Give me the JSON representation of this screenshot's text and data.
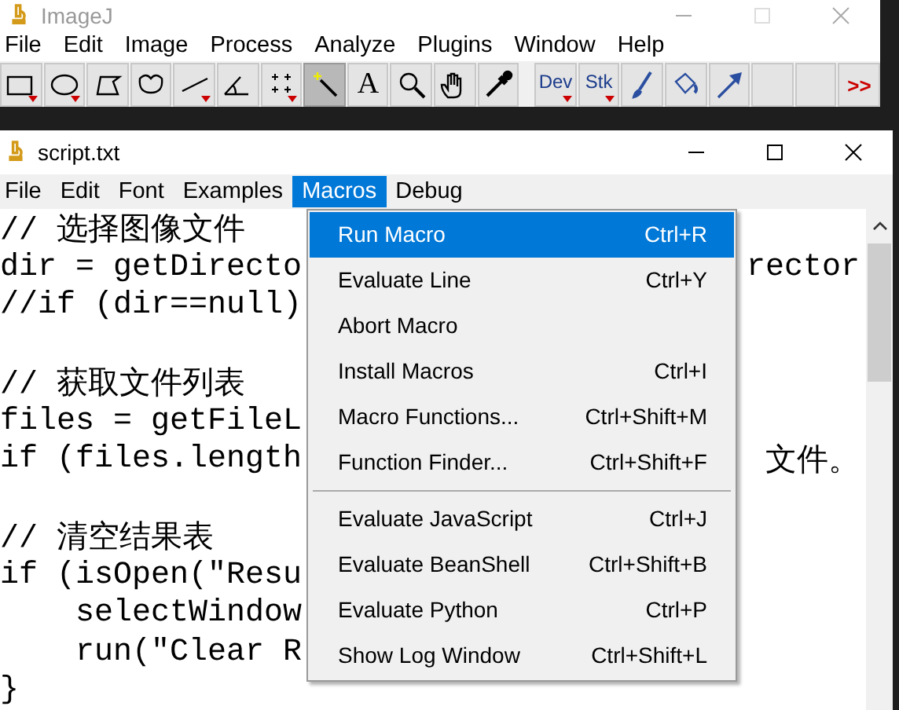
{
  "imagej": {
    "title": "ImageJ",
    "menu": [
      "File",
      "Edit",
      "Image",
      "Process",
      "Analyze",
      "Plugins",
      "Window",
      "Help"
    ],
    "tools": [
      {
        "kind": "rect",
        "selected": false,
        "has_menu": true
      },
      {
        "kind": "oval",
        "selected": false,
        "has_menu": true
      },
      {
        "kind": "polygon",
        "selected": false,
        "has_menu": false
      },
      {
        "kind": "freehand",
        "selected": false,
        "has_menu": false
      },
      {
        "kind": "line",
        "selected": false,
        "has_menu": true
      },
      {
        "kind": "angle",
        "selected": false,
        "has_menu": false
      },
      {
        "kind": "points",
        "selected": false,
        "has_menu": true
      },
      {
        "kind": "wand",
        "selected": true,
        "has_menu": false
      },
      {
        "kind": "textglyph",
        "selected": false,
        "has_menu": false,
        "label": "A"
      },
      {
        "kind": "magnifier",
        "selected": false,
        "has_menu": false
      },
      {
        "kind": "hand",
        "selected": false,
        "has_menu": false
      },
      {
        "kind": "dropper",
        "selected": false,
        "has_menu": false
      },
      {
        "kind": "label",
        "selected": false,
        "has_menu": true,
        "label": "Dev",
        "gap": true
      },
      {
        "kind": "label",
        "selected": false,
        "has_menu": true,
        "label": "Stk"
      },
      {
        "kind": "brush",
        "selected": false,
        "has_menu": false
      },
      {
        "kind": "bucket",
        "selected": false,
        "has_menu": false
      },
      {
        "kind": "arrow",
        "selected": false,
        "has_menu": false
      },
      {
        "kind": "blank",
        "selected": false,
        "has_menu": false
      },
      {
        "kind": "blank",
        "selected": false,
        "has_menu": false
      },
      {
        "kind": "more",
        "selected": false,
        "has_menu": false,
        "label": ">>"
      }
    ]
  },
  "editor": {
    "title": "script.txt",
    "menu": [
      {
        "label": "File",
        "selected": false
      },
      {
        "label": "Edit",
        "selected": false
      },
      {
        "label": "Font",
        "selected": false
      },
      {
        "label": "Examples",
        "selected": false
      },
      {
        "label": "Macros",
        "selected": true
      },
      {
        "label": "Debug",
        "selected": false
      }
    ],
    "blocks": [
      {
        "lines": [
          {
            "text": "// 选择图像文件"
          },
          {
            "text": "dir = getDirecto",
            "tail": "rector"
          },
          {
            "text": "//if (dir==null)"
          }
        ]
      },
      {
        "lines": [
          {
            "text": "// 获取文件列表"
          },
          {
            "text": "files = getFileL"
          },
          {
            "text": "if (files.length",
            "tail": "文件。"
          }
        ]
      },
      {
        "lines": [
          {
            "text": "// 清空结果表"
          },
          {
            "text": "if (isOpen(\"Resu"
          },
          {
            "text": "    selectWindow"
          },
          {
            "text": "    run(\"Clear R"
          },
          {
            "text": "}"
          }
        ]
      }
    ]
  },
  "dropdown": {
    "items": [
      {
        "label": "Run Macro",
        "shortcut": "Ctrl+R",
        "selected": true
      },
      {
        "label": "Evaluate Line",
        "shortcut": "Ctrl+Y",
        "selected": false
      },
      {
        "label": "Abort Macro",
        "selected": false
      },
      {
        "label": "Install Macros",
        "shortcut": "Ctrl+I",
        "selected": false
      },
      {
        "label": "Macro Functions...",
        "shortcut": "Ctrl+Shift+M",
        "selected": false
      },
      {
        "label": "Function Finder...",
        "shortcut": "Ctrl+Shift+F",
        "selected": false,
        "separator_after": true
      },
      {
        "label": "Evaluate JavaScript",
        "shortcut": "Ctrl+J",
        "selected": false
      },
      {
        "label": "Evaluate BeanShell",
        "shortcut": "Ctrl+Shift+B",
        "selected": false
      },
      {
        "label": "Evaluate Python",
        "shortcut": "Ctrl+P",
        "selected": false
      },
      {
        "label": "Show Log Window",
        "shortcut": "Ctrl+Shift+L",
        "selected": false
      }
    ]
  }
}
